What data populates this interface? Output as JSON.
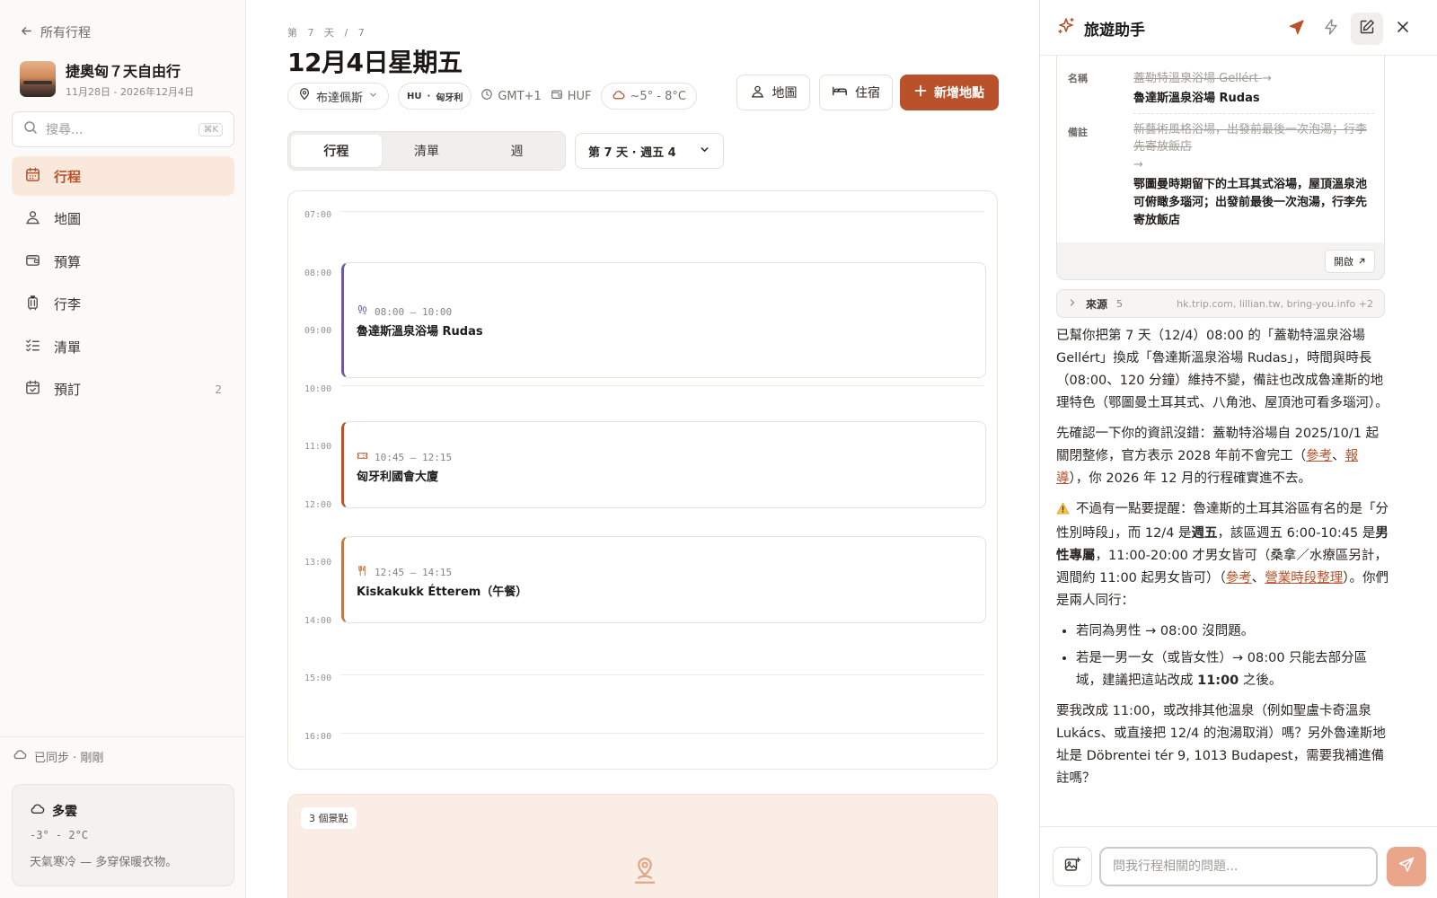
{
  "sidebar": {
    "back_label": "所有行程",
    "trip_title": "捷奧匈７天自由行",
    "trip_start": "11月28日",
    "trip_sep": " - ",
    "trip_end": "2026年12月4日",
    "search_placeholder": "搜尋...",
    "search_shortcut": "⌘K",
    "nav": [
      {
        "label": "行程",
        "icon": "calendar-icon",
        "active": true
      },
      {
        "label": "地圖",
        "icon": "map-pin-person-icon"
      },
      {
        "label": "預算",
        "icon": "wallet-icon"
      },
      {
        "label": "行李",
        "icon": "luggage-icon"
      },
      {
        "label": "清單",
        "icon": "checklist-icon"
      },
      {
        "label": "預訂",
        "icon": "calendar-check-icon",
        "count": "2"
      }
    ],
    "sync_status": "已同步 · 剛剛",
    "weather": {
      "condition": "多雲",
      "range": "-3° - 2°C",
      "note": "天氣寒冷 — 多穿保暖衣物。"
    }
  },
  "main": {
    "day_label": "第 7 天 / 7",
    "day_title": "12月4日星期五",
    "city": "布達佩斯",
    "country_code": "HU",
    "country_sep": "·",
    "country": "匈牙利",
    "timezone": "GMT+1",
    "currency": "HUF",
    "weather": "~5° - 8°C",
    "map_button": "地圖",
    "stay_button": "住宿",
    "add_button": "新增地點",
    "tabs": [
      {
        "label": "行程",
        "active": true
      },
      {
        "label": "清單"
      },
      {
        "label": "週"
      }
    ],
    "day_select": "第 7 天 · 週五 4",
    "hours": [
      "07:00",
      "08:00",
      "09:00",
      "10:00",
      "11:00",
      "12:00",
      "13:00",
      "14:00",
      "15:00",
      "16:00"
    ],
    "events": [
      {
        "time": "08:00 – 10:00",
        "name": "魯達斯溫泉浴場 Rudas",
        "icon": "footprints-icon",
        "accent": "#6b5aa6"
      },
      {
        "time": "10:45 – 12:15",
        "name": "匈牙利國會大廈",
        "icon": "ticket-icon",
        "accent": "#b9512a"
      },
      {
        "time": "12:45 – 14:15",
        "name": "Kiskakukk Étterem（午餐）",
        "icon": "fork-knife-icon",
        "accent": "#c07a4a"
      }
    ],
    "spots_badge": "3 個景點"
  },
  "assistant": {
    "title": "旅遊助手",
    "diff": {
      "name_key": "名稱",
      "name_old": "蓋勒特溫泉浴場 Gellért",
      "name_new": "魯達斯溫泉浴場 Rudas",
      "note_key": "備註",
      "note_old": "新藝術風格浴場，出發前最後一次泡湯；行李先寄放飯店",
      "note_new": "鄂圖曼時期留下的土耳其式浴場，屋頂溫泉池可俯瞰多瑙河；出發前最後一次泡湯，行李先寄放飯店",
      "arrow": "→",
      "open_label": "開啟"
    },
    "sources": {
      "label": "來源",
      "count": "5",
      "list": "hk.trip.com, lillian.tw, bring-you.info +2"
    },
    "message": {
      "p1": "已幫你把第 7 天（12/4）08:00 的「蓋勒特溫泉浴場 Gellért」換成「魯達斯溫泉浴場 Rudas」，時間與時長（08:00、120 分鐘）維持不變，備註也改成魯達斯的地理特色（鄂圖曼土耳其式、八角池、屋頂池可看多瑙河）。",
      "p2_a": "先確認一下你的資訊沒錯：蓋勒特浴場自 2025/10/1 起關閉整修，官方表示 2028 年前不會完工（",
      "p2_link1": "參考",
      "p2_sep": "、",
      "p2_link2": "報導",
      "p2_b": "），你 2026 年 12 月的行程確實進不去。",
      "p3_a": "不過有一點要提醒：魯達斯的土耳其浴區有名的是「分性別時段」，而 12/4 是",
      "p3_bold1": "週五",
      "p3_b": "，該區週五 6:00-10:45 是",
      "p3_bold2": "男性專屬",
      "p3_c": "，11:00-20:00 才男女皆可（桑拿／水療區另計，週間約 11:00 起男女皆可）（",
      "p3_link1": "參考",
      "p3_sep": "、",
      "p3_link2": "營業時段整理",
      "p3_d": "）。你們是兩人同行：",
      "li1": "若同為男性 → 08:00 沒問題。",
      "li2_a": "若是一男一女（或皆女性）→ 08:00 只能去部分區域，建議把這站改成 ",
      "li2_bold": "11:00",
      "li2_b": " 之後。",
      "p4": "要我改成 11:00，或改排其他溫泉（例如聖盧卡奇溫泉 Lukács、或直接把 12/4 的泡湯取消）嗎？另外魯達斯地址是 Döbrentei tér 9, 1013 Budapest，需要我補進備註嗎？"
    },
    "input_placeholder": "問我行程相關的問題..."
  },
  "colors": {
    "accent": "#b9512a",
    "accent_soft": "#fbe8dc",
    "event_purple": "#6b5aa6"
  }
}
